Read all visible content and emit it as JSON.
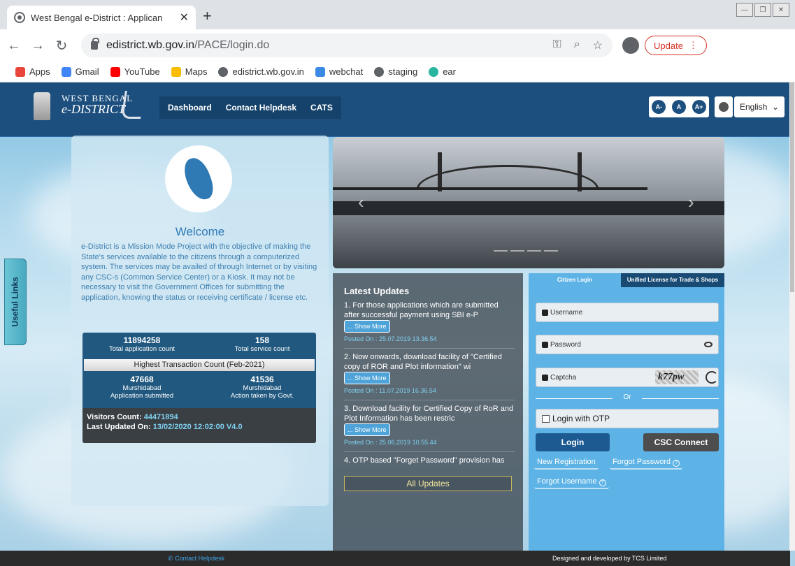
{
  "browser": {
    "tab_title": "West Bengal e-District : Applican",
    "tab_close": "✕",
    "new_tab": "+",
    "url_host": "edistrict.wb.gov.in",
    "url_path": "/PACE/login.do",
    "update_label": "Update",
    "bookmarks": [
      {
        "label": "Apps",
        "color": "#e8453c"
      },
      {
        "label": "Gmail",
        "color": "#4285f4"
      },
      {
        "label": "YouTube",
        "color": "#ff0000"
      },
      {
        "label": "Maps",
        "color": "#fbbc04"
      },
      {
        "label": "edistrict.wb.gov.in",
        "color": "#5f6368"
      },
      {
        "label": "webchat",
        "color": "#3b8ae6"
      },
      {
        "label": "staging",
        "color": "#5f6368"
      },
      {
        "label": "ear",
        "color": "#29b6a0"
      }
    ]
  },
  "header": {
    "brand_line1": "WEST BENGAL",
    "brand_line2": "e-DISTRICT",
    "nav": [
      "Dashboard",
      "Contact Helpdesk",
      "CATS"
    ],
    "font_buttons": [
      "A-",
      "A",
      "A+"
    ],
    "language": "English"
  },
  "useful_links": "Useful Links",
  "welcome": {
    "title": "Welcome",
    "text": "e-District is a Mission Mode Project with the objective of making the State's services available to the citizens through a computerized system. The services may be availed of through Internet or by visiting any CSC-s (Common Service Center) or a Kiosk. It may not be necessary to visit the Government Offices for submitting the application, knowing the status or receiving certificate / license etc.",
    "total_app_count": "11894258",
    "total_app_label": "Total application count",
    "total_service_count": "158",
    "total_service_label": "Total service count",
    "highest_label": "Highest Transaction Count (Feb-2021)",
    "left_count": "47668",
    "left_district": "Murshidabad",
    "left_label": "Application submitted",
    "right_count": "41536",
    "right_district": "Murshidabad",
    "right_label": "Action taken by Govt.",
    "visitors_label": "Visitors Count:",
    "visitors_value": "44471894",
    "updated_label": "Last Updated On:",
    "updated_value": "13/02/2020 12:02:00 V4.0"
  },
  "updates": {
    "title": "Latest Updates",
    "items": [
      {
        "text": "1. For those applications which are submitted after successful payment using SBI e-P",
        "more": "... Show More",
        "posted": "Posted On : 25.07.2019 13.36.54"
      },
      {
        "text": "2. Now onwards, download facility of \"Certified copy of ROR and Plot information\" wi",
        "more": "... Show More",
        "posted": "Posted On : 11.07.2019 16.36.54"
      },
      {
        "text": "3. Download facility for Certified Copy of RoR and Plot Information has been restric",
        "more": "... Show More",
        "posted": "Posted On : 25.06.2019 10.55.44"
      },
      {
        "text": "4. OTP based \"Forget Password\" provision has",
        "more": "",
        "posted": ""
      }
    ],
    "all_label": "All Updates"
  },
  "login": {
    "tab_citizen": "Citizen Login",
    "tab_unified": "Unified License for Trade & Shops",
    "username": "Username",
    "password": "Password",
    "captcha": "Captcha",
    "captcha_text": "k77pw",
    "or": "Or",
    "otp": "Login with OTP",
    "login_btn": "Login",
    "csc_btn": "CSC Connect",
    "new_reg": "New Registration",
    "forgot_pwd": "Forgot Password",
    "forgot_user": "Forgot Username"
  },
  "footer": {
    "contact": "Contact Helpdesk",
    "credit": "Designed and developed by TCS Limited"
  }
}
